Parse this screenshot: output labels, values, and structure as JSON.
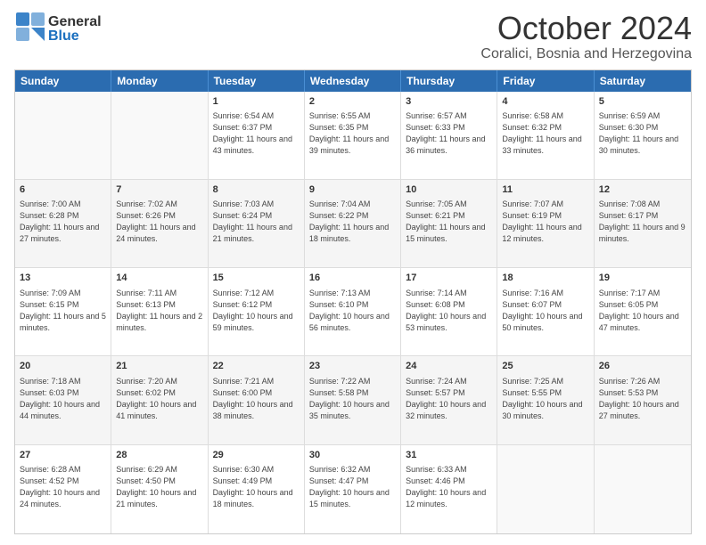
{
  "header": {
    "logo": {
      "general": "General",
      "blue": "Blue"
    },
    "month": "October 2024",
    "location": "Coralici, Bosnia and Herzegovina"
  },
  "calendar": {
    "days": [
      "Sunday",
      "Monday",
      "Tuesday",
      "Wednesday",
      "Thursday",
      "Friday",
      "Saturday"
    ],
    "rows": [
      [
        {
          "day": "",
          "sunrise": "",
          "sunset": "",
          "daylight": "",
          "empty": true
        },
        {
          "day": "",
          "sunrise": "",
          "sunset": "",
          "daylight": "",
          "empty": true
        },
        {
          "day": "1",
          "sunrise": "Sunrise: 6:54 AM",
          "sunset": "Sunset: 6:37 PM",
          "daylight": "Daylight: 11 hours and 43 minutes.",
          "empty": false
        },
        {
          "day": "2",
          "sunrise": "Sunrise: 6:55 AM",
          "sunset": "Sunset: 6:35 PM",
          "daylight": "Daylight: 11 hours and 39 minutes.",
          "empty": false
        },
        {
          "day": "3",
          "sunrise": "Sunrise: 6:57 AM",
          "sunset": "Sunset: 6:33 PM",
          "daylight": "Daylight: 11 hours and 36 minutes.",
          "empty": false
        },
        {
          "day": "4",
          "sunrise": "Sunrise: 6:58 AM",
          "sunset": "Sunset: 6:32 PM",
          "daylight": "Daylight: 11 hours and 33 minutes.",
          "empty": false
        },
        {
          "day": "5",
          "sunrise": "Sunrise: 6:59 AM",
          "sunset": "Sunset: 6:30 PM",
          "daylight": "Daylight: 11 hours and 30 minutes.",
          "empty": false
        }
      ],
      [
        {
          "day": "6",
          "sunrise": "Sunrise: 7:00 AM",
          "sunset": "Sunset: 6:28 PM",
          "daylight": "Daylight: 11 hours and 27 minutes.",
          "empty": false
        },
        {
          "day": "7",
          "sunrise": "Sunrise: 7:02 AM",
          "sunset": "Sunset: 6:26 PM",
          "daylight": "Daylight: 11 hours and 24 minutes.",
          "empty": false
        },
        {
          "day": "8",
          "sunrise": "Sunrise: 7:03 AM",
          "sunset": "Sunset: 6:24 PM",
          "daylight": "Daylight: 11 hours and 21 minutes.",
          "empty": false
        },
        {
          "day": "9",
          "sunrise": "Sunrise: 7:04 AM",
          "sunset": "Sunset: 6:22 PM",
          "daylight": "Daylight: 11 hours and 18 minutes.",
          "empty": false
        },
        {
          "day": "10",
          "sunrise": "Sunrise: 7:05 AM",
          "sunset": "Sunset: 6:21 PM",
          "daylight": "Daylight: 11 hours and 15 minutes.",
          "empty": false
        },
        {
          "day": "11",
          "sunrise": "Sunrise: 7:07 AM",
          "sunset": "Sunset: 6:19 PM",
          "daylight": "Daylight: 11 hours and 12 minutes.",
          "empty": false
        },
        {
          "day": "12",
          "sunrise": "Sunrise: 7:08 AM",
          "sunset": "Sunset: 6:17 PM",
          "daylight": "Daylight: 11 hours and 9 minutes.",
          "empty": false
        }
      ],
      [
        {
          "day": "13",
          "sunrise": "Sunrise: 7:09 AM",
          "sunset": "Sunset: 6:15 PM",
          "daylight": "Daylight: 11 hours and 5 minutes.",
          "empty": false
        },
        {
          "day": "14",
          "sunrise": "Sunrise: 7:11 AM",
          "sunset": "Sunset: 6:13 PM",
          "daylight": "Daylight: 11 hours and 2 minutes.",
          "empty": false
        },
        {
          "day": "15",
          "sunrise": "Sunrise: 7:12 AM",
          "sunset": "Sunset: 6:12 PM",
          "daylight": "Daylight: 10 hours and 59 minutes.",
          "empty": false
        },
        {
          "day": "16",
          "sunrise": "Sunrise: 7:13 AM",
          "sunset": "Sunset: 6:10 PM",
          "daylight": "Daylight: 10 hours and 56 minutes.",
          "empty": false
        },
        {
          "day": "17",
          "sunrise": "Sunrise: 7:14 AM",
          "sunset": "Sunset: 6:08 PM",
          "daylight": "Daylight: 10 hours and 53 minutes.",
          "empty": false
        },
        {
          "day": "18",
          "sunrise": "Sunrise: 7:16 AM",
          "sunset": "Sunset: 6:07 PM",
          "daylight": "Daylight: 10 hours and 50 minutes.",
          "empty": false
        },
        {
          "day": "19",
          "sunrise": "Sunrise: 7:17 AM",
          "sunset": "Sunset: 6:05 PM",
          "daylight": "Daylight: 10 hours and 47 minutes.",
          "empty": false
        }
      ],
      [
        {
          "day": "20",
          "sunrise": "Sunrise: 7:18 AM",
          "sunset": "Sunset: 6:03 PM",
          "daylight": "Daylight: 10 hours and 44 minutes.",
          "empty": false
        },
        {
          "day": "21",
          "sunrise": "Sunrise: 7:20 AM",
          "sunset": "Sunset: 6:02 PM",
          "daylight": "Daylight: 10 hours and 41 minutes.",
          "empty": false
        },
        {
          "day": "22",
          "sunrise": "Sunrise: 7:21 AM",
          "sunset": "Sunset: 6:00 PM",
          "daylight": "Daylight: 10 hours and 38 minutes.",
          "empty": false
        },
        {
          "day": "23",
          "sunrise": "Sunrise: 7:22 AM",
          "sunset": "Sunset: 5:58 PM",
          "daylight": "Daylight: 10 hours and 35 minutes.",
          "empty": false
        },
        {
          "day": "24",
          "sunrise": "Sunrise: 7:24 AM",
          "sunset": "Sunset: 5:57 PM",
          "daylight": "Daylight: 10 hours and 32 minutes.",
          "empty": false
        },
        {
          "day": "25",
          "sunrise": "Sunrise: 7:25 AM",
          "sunset": "Sunset: 5:55 PM",
          "daylight": "Daylight: 10 hours and 30 minutes.",
          "empty": false
        },
        {
          "day": "26",
          "sunrise": "Sunrise: 7:26 AM",
          "sunset": "Sunset: 5:53 PM",
          "daylight": "Daylight: 10 hours and 27 minutes.",
          "empty": false
        }
      ],
      [
        {
          "day": "27",
          "sunrise": "Sunrise: 6:28 AM",
          "sunset": "Sunset: 4:52 PM",
          "daylight": "Daylight: 10 hours and 24 minutes.",
          "empty": false
        },
        {
          "day": "28",
          "sunrise": "Sunrise: 6:29 AM",
          "sunset": "Sunset: 4:50 PM",
          "daylight": "Daylight: 10 hours and 21 minutes.",
          "empty": false
        },
        {
          "day": "29",
          "sunrise": "Sunrise: 6:30 AM",
          "sunset": "Sunset: 4:49 PM",
          "daylight": "Daylight: 10 hours and 18 minutes.",
          "empty": false
        },
        {
          "day": "30",
          "sunrise": "Sunrise: 6:32 AM",
          "sunset": "Sunset: 4:47 PM",
          "daylight": "Daylight: 10 hours and 15 minutes.",
          "empty": false
        },
        {
          "day": "31",
          "sunrise": "Sunrise: 6:33 AM",
          "sunset": "Sunset: 4:46 PM",
          "daylight": "Daylight: 10 hours and 12 minutes.",
          "empty": false
        },
        {
          "day": "",
          "sunrise": "",
          "sunset": "",
          "daylight": "",
          "empty": true
        },
        {
          "day": "",
          "sunrise": "",
          "sunset": "",
          "daylight": "",
          "empty": true
        }
      ]
    ]
  }
}
